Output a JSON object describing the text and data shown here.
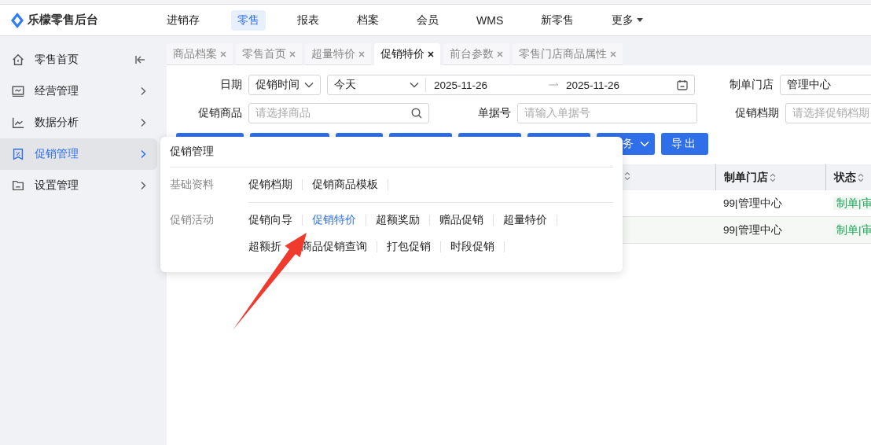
{
  "app": {
    "title": "乐檬零售后台"
  },
  "top_nav": [
    {
      "label": "进销存",
      "selected": false
    },
    {
      "label": "零售",
      "selected": true
    },
    {
      "label": "报表",
      "selected": false
    },
    {
      "label": "档案",
      "selected": false
    },
    {
      "label": "会员",
      "selected": false
    },
    {
      "label": "WMS",
      "selected": false
    },
    {
      "label": "新零售",
      "selected": false
    },
    {
      "label": "更多",
      "selected": false,
      "kind": "dropdown"
    }
  ],
  "sidebar": {
    "items": [
      {
        "label": "零售首页",
        "selected": false,
        "kind": "collapse"
      },
      {
        "label": "经营管理",
        "selected": false,
        "kind": "chevron"
      },
      {
        "label": "数据分析",
        "selected": false,
        "kind": "chevron"
      },
      {
        "label": "促销管理",
        "selected": true,
        "kind": "chevron"
      },
      {
        "label": "设置管理",
        "selected": false,
        "kind": "chevron"
      }
    ]
  },
  "tabs": [
    {
      "label": "商品档案",
      "selected": false
    },
    {
      "label": "零售首页",
      "selected": false
    },
    {
      "label": "超量特价",
      "selected": false
    },
    {
      "label": "促销特价",
      "selected": true
    },
    {
      "label": "前台参数",
      "selected": false
    },
    {
      "label": "零售门店商品属性",
      "selected": false
    }
  ],
  "filters": {
    "date_label": "日期",
    "date_type": "促销时间",
    "period": "今天",
    "start_date": "2025-11-26",
    "end_date": "2025-11-26",
    "store_label": "制单门店",
    "store_value": "管理中心",
    "product_label": "促销商品",
    "product_placeholder": "请选择商品",
    "order_label": "单据号",
    "order_placeholder": "请输入单据号",
    "schedule_label": "促销档期",
    "schedule_placeholder": "请选择促销档期"
  },
  "toolbar": {
    "more_label": "务",
    "export_label": "导出"
  },
  "table": {
    "columns": [
      "制单门店",
      "状态"
    ],
    "rows": [
      {
        "store": "99|管理中心",
        "status": "制单|审"
      },
      {
        "store": "99|管理中心",
        "status": "制单|审"
      }
    ]
  },
  "menu_popup": {
    "title": "促销管理",
    "groups": [
      {
        "label": "基础资料",
        "items": [
          {
            "label": "促销档期",
            "selected": false
          },
          {
            "label": "促销商品模板",
            "selected": false
          }
        ]
      },
      {
        "label": "促销活动",
        "items": [
          {
            "label": "促销向导",
            "selected": false
          },
          {
            "label": "促销特价",
            "selected": true
          },
          {
            "label": "超额奖励",
            "selected": false
          },
          {
            "label": "赠品促销",
            "selected": false
          },
          {
            "label": "超量特价",
            "selected": false
          },
          {
            "label": "超额折",
            "selected": false
          },
          {
            "label": "商品促销查询",
            "selected": false
          },
          {
            "label": "打包促销",
            "selected": false
          },
          {
            "label": "时段促销",
            "selected": false
          }
        ]
      }
    ]
  }
}
